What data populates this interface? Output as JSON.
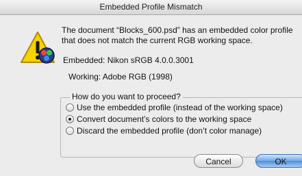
{
  "window": {
    "title": "Embedded Profile Mismatch"
  },
  "message": {
    "line1": "The document “Blocks_600.psd” has an embedded color profile",
    "line2": "that does not match the current RGB working space."
  },
  "profiles": {
    "embedded": "Embedded: Nikon sRGB 4.0.0.3001",
    "working": "Working: Adobe RGB (1998)"
  },
  "options": {
    "legend": "How do you want to proceed?",
    "items": [
      {
        "label": "Use the embedded profile (instead of the working space)",
        "selected": false
      },
      {
        "label": "Convert document’s colors to the working space",
        "selected": true
      },
      {
        "label": "Discard the embedded profile (don’t color manage)",
        "selected": false
      }
    ]
  },
  "buttons": {
    "cancel": "Cancel",
    "ok": "OK"
  },
  "icons": {
    "dialog": "warning-triangle-icon",
    "app": "colorsync-icon"
  },
  "colors": {
    "default_button": "#6ea6e6",
    "warning": "#f5d200"
  }
}
